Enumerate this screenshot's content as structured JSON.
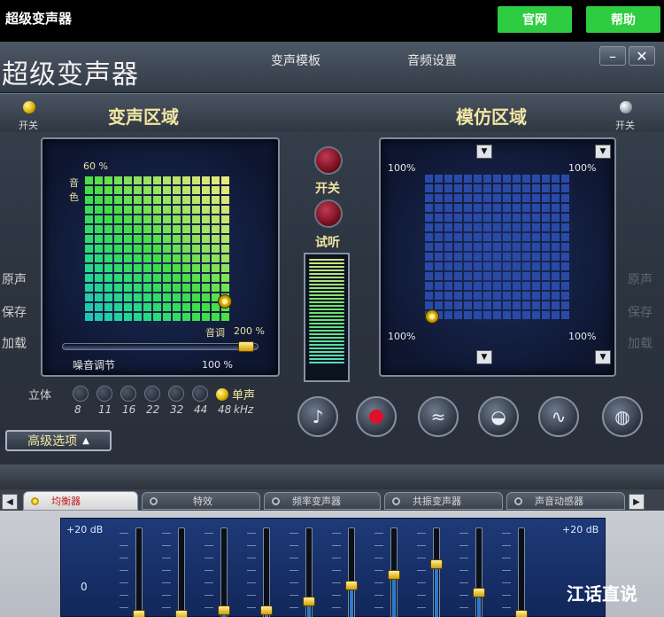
{
  "page": {
    "top_title": "超级变声器",
    "website_button": "官网",
    "help_button": "帮助",
    "watermark": "江话直说"
  },
  "app": {
    "title": "超级变声器",
    "menu": [
      "变声模板",
      "音频设置"
    ],
    "minimize": "–",
    "close": "✕"
  },
  "voice_zone": {
    "title": "变声区域",
    "switch_label": "开关",
    "timbre_label": "音色",
    "timbre_pct": "60 %",
    "pitch_label": "音调",
    "pitch_pct": "200 %",
    "noise_label": "噪音调节",
    "noise_pct": "100 %",
    "side_labels": [
      "原声",
      "保存",
      "加载"
    ]
  },
  "imitate_zone": {
    "title": "模仿区域",
    "switch_label": "开关",
    "corner_labels": [
      "100%",
      "100%",
      "100%",
      "100%"
    ],
    "side_labels": [
      "原声",
      "保存",
      "加载"
    ]
  },
  "center": {
    "switch_label": "开关",
    "preview_label": "试听"
  },
  "stereo": {
    "label": "立体",
    "values": [
      "8",
      "11",
      "16",
      "22",
      "32",
      "44",
      "48"
    ],
    "selected_index": 6,
    "mono_label": "单声",
    "unit": "kHz"
  },
  "function_buttons": [
    "music-icon",
    "record-icon",
    "equalizer-icon",
    "mask-icon",
    "wave-icon",
    "globe-icon"
  ],
  "advanced": {
    "label": "高级选项",
    "arrow": "▲"
  },
  "tabs": [
    {
      "label": "均衡器",
      "active": true
    },
    {
      "label": "特效",
      "active": false
    },
    {
      "label": "频率变声器",
      "active": false
    },
    {
      "label": "共振变声器",
      "active": false
    },
    {
      "label": "声音动感器",
      "active": false
    }
  ],
  "equalizer": {
    "left_top_label": "+20 dB",
    "right_top_label": "+20 dB",
    "zero_label": "0",
    "band_levels": [
      0.05,
      0.05,
      0.1,
      0.1,
      0.2,
      0.38,
      0.5,
      0.62,
      0.3,
      0.05
    ]
  },
  "colors": {
    "website_button": "#2ecc40",
    "accent_text": "#f2e6a2",
    "panel_bg": "#14204a",
    "active_tab_text": "#c01818"
  }
}
